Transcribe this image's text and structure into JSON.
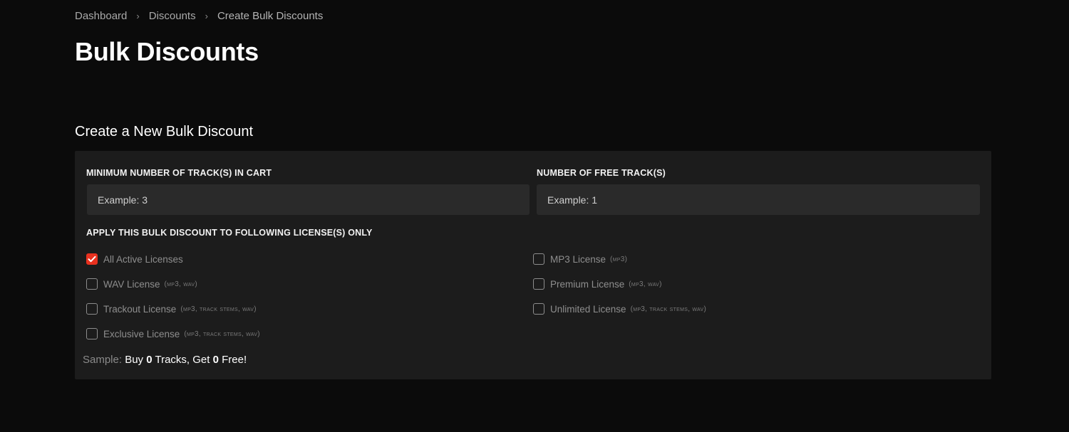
{
  "breadcrumb": {
    "items": [
      "Dashboard",
      "Discounts",
      "Create Bulk Discounts"
    ],
    "separator": "›"
  },
  "page": {
    "title": "Bulk Discounts",
    "section_title": "Create a New Bulk Discount"
  },
  "form": {
    "min_tracks": {
      "label": "Minimum number of track(s) in cart",
      "placeholder": "Example: 3",
      "value": ""
    },
    "free_tracks": {
      "label": "Number of free track(s)",
      "placeholder": "Example: 1",
      "value": ""
    },
    "licenses_label": "Apply this bulk discount to following license(s) only",
    "licenses": [
      {
        "name": "All Active Licenses",
        "formats": "",
        "checked": true
      },
      {
        "name": "MP3 License",
        "formats": "(MP3)",
        "checked": false
      },
      {
        "name": "WAV License",
        "formats": "(MP3, WAV)",
        "checked": false
      },
      {
        "name": "Premium License",
        "formats": "(MP3, WAV)",
        "checked": false
      },
      {
        "name": "Trackout License",
        "formats": "(MP3, TRACK STEMS, WAV)",
        "checked": false
      },
      {
        "name": "Unlimited License",
        "formats": "(MP3, TRACK STEMS, WAV)",
        "checked": false
      },
      {
        "name": "Exclusive License",
        "formats": "(MP3, TRACK STEMS, WAV)",
        "checked": false
      }
    ],
    "sample": {
      "prefix": "Sample:",
      "buy_word": "Buy",
      "buy_count": "0",
      "tracks_get": "Tracks, Get",
      "free_count": "0",
      "free_word": "Free!"
    }
  },
  "colors": {
    "background": "#0b0b0b",
    "card": "#1c1c1c",
    "input": "#2a2a2a",
    "accent": "#e8311f"
  },
  "icons": {
    "breadcrumb_separator": "chevron-right-icon",
    "checkbox_checked": "checkmark-icon"
  }
}
